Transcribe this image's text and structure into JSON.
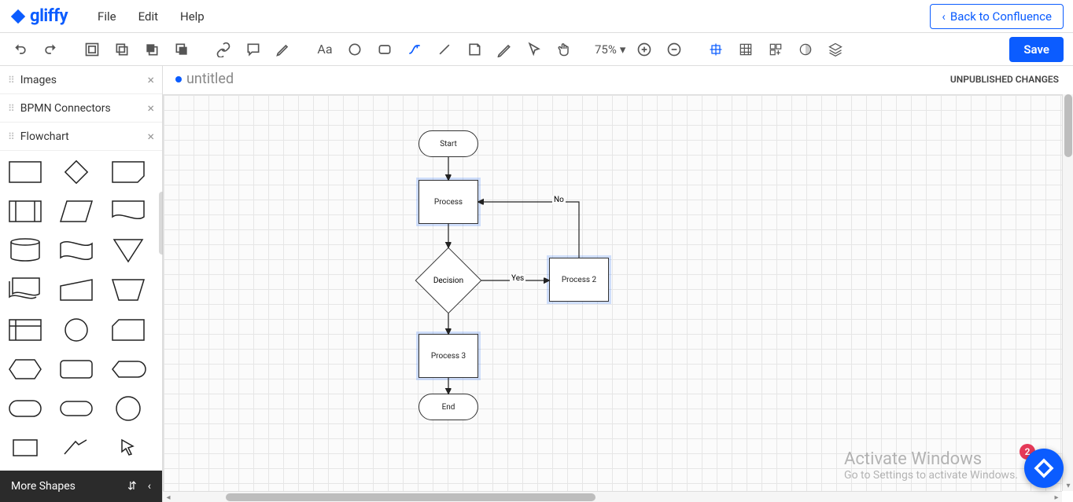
{
  "app": {
    "logo_text": "gliffy"
  },
  "menu": {
    "file": "File",
    "edit": "Edit",
    "help": "Help"
  },
  "back_button": "Back to Confluence",
  "toolbar": {
    "zoom": "75%",
    "save": "Save"
  },
  "sidebar": {
    "panels": [
      {
        "title": "Images"
      },
      {
        "title": "BPMN Connectors"
      },
      {
        "title": "Flowchart"
      }
    ],
    "more_shapes": "More Shapes"
  },
  "document": {
    "title": "untitled",
    "status": "UNPUBLISHED CHANGES"
  },
  "flowchart": {
    "nodes": {
      "start": "Start",
      "process": "Process",
      "decision": "Decision",
      "process2": "Process 2",
      "process3": "Process 3",
      "end": "End"
    },
    "edges": {
      "yes": "Yes",
      "no": "No"
    }
  },
  "notifications": {
    "count": "2"
  },
  "watermark": {
    "title": "Activate Windows",
    "sub": "Go to Settings to activate Windows."
  }
}
